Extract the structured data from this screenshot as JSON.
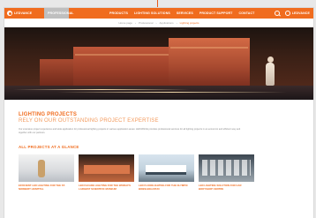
{
  "nav": {
    "brand": "LEDVANCE",
    "pro_tab": "PROFESSIONAL",
    "links": [
      "PRODUCTS",
      "LIGHTING SOLUTIONS",
      "SERVICES",
      "PRODUCT SUPPORT",
      "CONTACT"
    ],
    "region": "LEDVANCE"
  },
  "breadcrumb": [
    "Home page",
    "Professional",
    "Applications",
    "Lighting projects"
  ],
  "page": {
    "title": "LIGHTING PROJECTS",
    "subtitle": "RELY ON OUR OUTSTANDING PROJECT EXPERTISE",
    "intro": "Our extensive project experience and wide application for professional lighting projects in various application areas: LEDVANCE provides professional services for all lighting projects in an economic and efficient way and together with our partners.",
    "section_title": "ALL PROJECTS AT A GLANCE"
  },
  "cards": [
    {
      "label": "EFFICIENT LED LIGHTING FOR THE ST. NORBERT HOSPITAL"
    },
    {
      "label": "LED FACADE LIGHTING FOR THE WORLD'S LARGEST SCIENTIFIC MUSEUM"
    },
    {
      "label": "LED FLOODLIGHTING FOR THE OLYMPIC BOBSLEIGH RUN"
    },
    {
      "label": "LED LIGHTING SOLUTION FOR CAR BODYSHOP CENTRE"
    }
  ]
}
